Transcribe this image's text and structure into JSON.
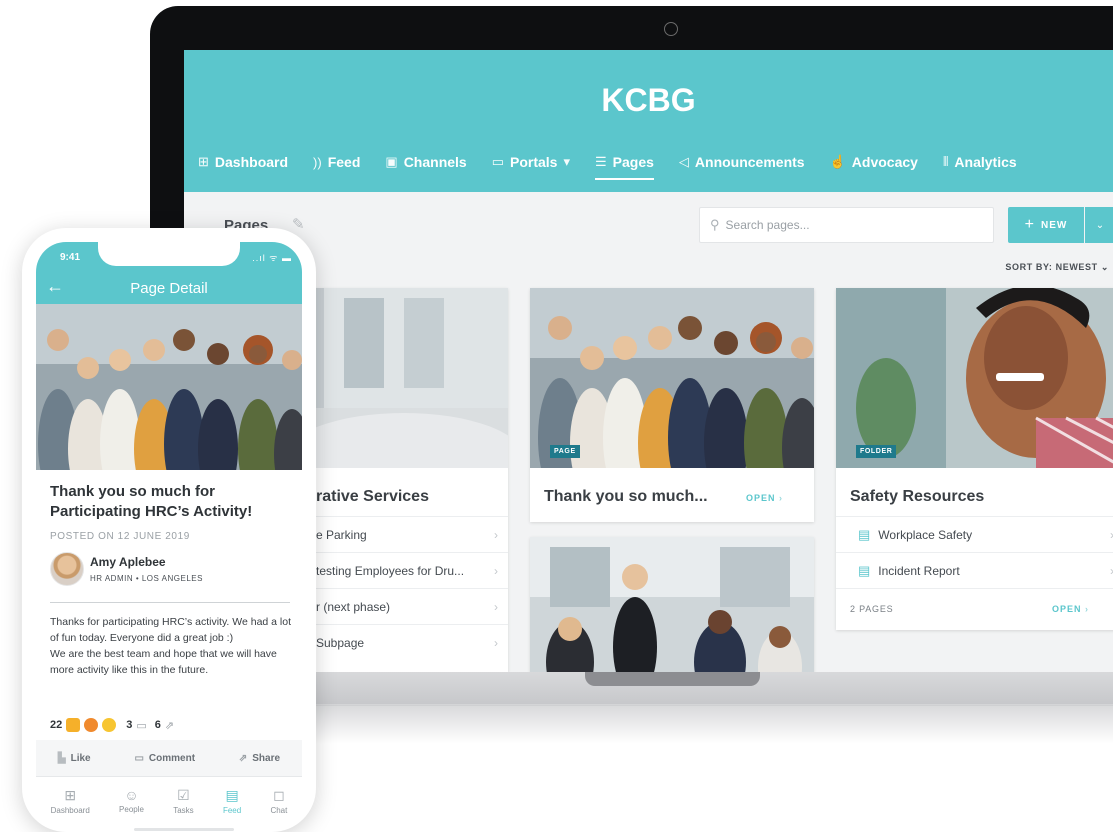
{
  "app": {
    "title": "KCBG"
  },
  "nav": [
    {
      "label": "Dashboard",
      "icon": "grid-icon",
      "glyph": "⊞"
    },
    {
      "label": "Feed",
      "icon": "rss-icon",
      "glyph": "\\"
    },
    {
      "label": "Channels",
      "icon": "tv-icon",
      "glyph": "▣"
    },
    {
      "label": "Portals",
      "icon": "window-icon",
      "glyph": "▭",
      "caret": "▾"
    },
    {
      "label": "Pages",
      "icon": "page-icon",
      "glyph": "☰",
      "active": true
    },
    {
      "label": "Announcements",
      "icon": "megaphone-icon",
      "glyph": "◁"
    },
    {
      "label": "Advocacy",
      "icon": "hand-icon",
      "glyph": "☝"
    },
    {
      "label": "Analytics",
      "icon": "bars-icon",
      "glyph": "⫴"
    }
  ],
  "toolbar": {
    "heading": "Pages",
    "search_placeholder": "Search pages...",
    "new_label": "NEW",
    "sort_label": "SORT BY: NEWEST"
  },
  "cards": {
    "admin": {
      "title": "rative Services",
      "rows": [
        "e Parking",
        "testing Employees for Dru...",
        "r (next phase)",
        "Subpage"
      ]
    },
    "thanks": {
      "tag": "PAGE",
      "title": "Thank you so much...",
      "open": "OPEN"
    },
    "safety": {
      "tag": "FOLDER",
      "title": "Safety Resources",
      "rows": [
        "Workplace Safety",
        "Incident Report"
      ],
      "count": "2 PAGES",
      "open": "OPEN"
    }
  },
  "phone": {
    "time": "9:41",
    "status": "..ıl ᯤ ▬",
    "header": "Page Detail",
    "post_title": "Thank you so much for Participating HRC’s Activity!",
    "posted": "POSTED ON 12 JUNE 2019",
    "author": "Amy Aplebee",
    "role": "HR ADMIN • LOS ANGELES",
    "body1": "Thanks for participating HRC’s activity. We had a lot of fun today. Everyone did a great job :)",
    "body2": "We are the best team and hope that we will have more activity like this in the future.",
    "reactions": "22",
    "comments": "3",
    "shares": "6",
    "actions": {
      "like": "Like",
      "comment": "Comment",
      "share": "Share"
    },
    "tabs": [
      "Dashboard",
      "People",
      "Tasks",
      "Feed",
      "Chat"
    ],
    "active_tab": "Feed"
  },
  "colors": {
    "accent": "#5bc6cc",
    "tag": "#1f7a8c"
  }
}
